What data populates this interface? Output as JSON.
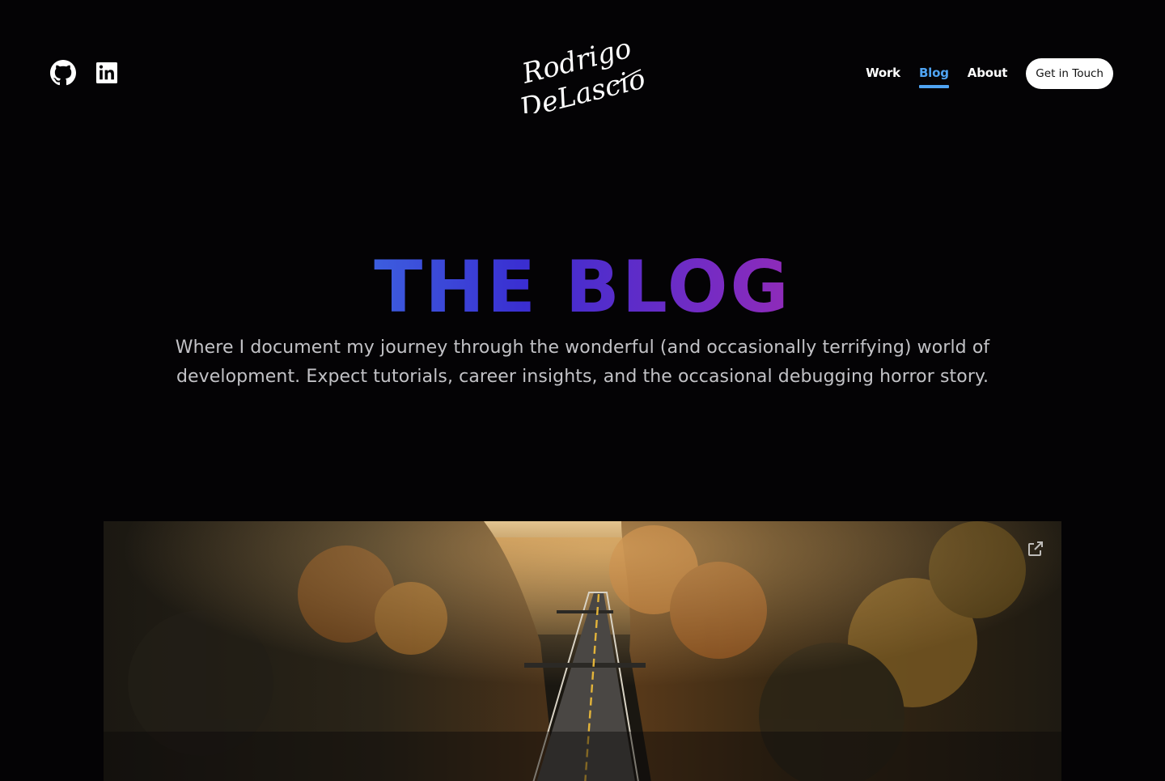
{
  "header": {
    "logo_text_line1": "Rodrigo",
    "logo_text_line2": "DeLascio",
    "social": [
      {
        "name": "github-icon"
      },
      {
        "name": "linkedin-icon"
      }
    ],
    "nav": {
      "work": "Work",
      "blog": "Blog",
      "about": "About",
      "active": "Blog"
    },
    "cta": "Get in Touch"
  },
  "hero": {
    "title_word1": "THE",
    "title_word2": "BLOG",
    "subtitle": "Where I document my journey through the wonderful (and occasionally terrifying) world of development. Expect tutorials, career insights, and the occasional debugging horror story."
  },
  "feature": {
    "image_subject": "road-through-autumn-forest",
    "share_icon": "external-link-icon"
  },
  "colors": {
    "background": "#040305",
    "accent": "#4fa4f3",
    "gradient_start": "#3cc4f4",
    "gradient_mid": "#3a2ed1",
    "gradient_end": "#f02b8a",
    "subtitle": "#c2c2c6"
  }
}
